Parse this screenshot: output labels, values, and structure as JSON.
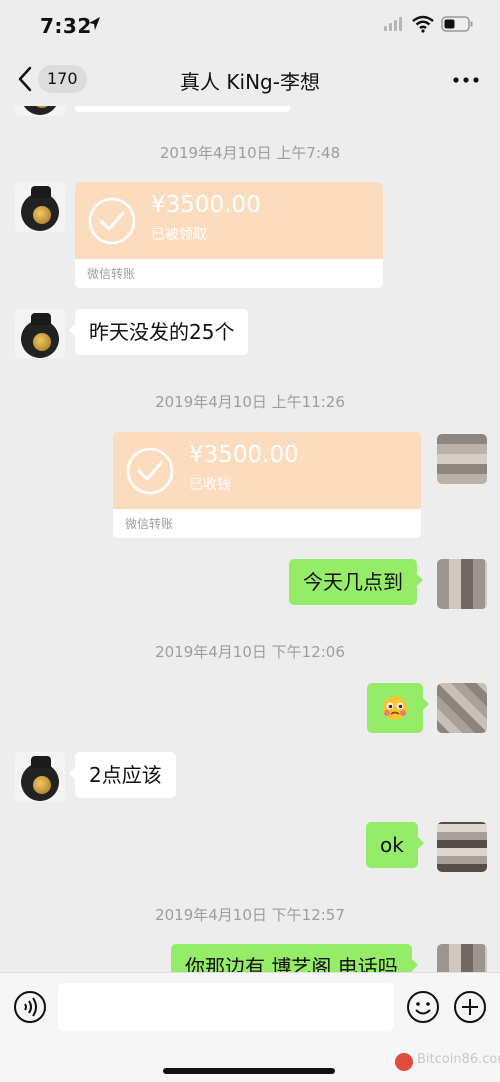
{
  "status_bar": {
    "time": "7:32",
    "icons": [
      "location-arrow-icon",
      "signal-icon",
      "wifi-icon",
      "battery-icon"
    ]
  },
  "nav": {
    "back_count": "170",
    "title": "真人 KiNg-李想",
    "icons": [
      "back-chevron-icon",
      "more-icon"
    ]
  },
  "messages": {
    "ts1": "2019年4月10日 上午7:48",
    "transfer1": {
      "amount": "¥3500.00",
      "status": "已被领取",
      "caption": "微信转账"
    },
    "msg1": "昨天没发的25个",
    "ts2": "2019年4月10日 上午11:26",
    "transfer2": {
      "amount": "¥3500.00",
      "status": "已收钱",
      "caption": "微信转账"
    },
    "msg2": "今天几点到",
    "ts3": "2019年4月10日 下午12:06",
    "msg3": "2点应该",
    "msg4": "ok",
    "ts4": "2019年4月10日 下午12:57",
    "msg5": "你那边有 博艺阁 电话吗"
  },
  "input_bar": {
    "placeholder": "",
    "icons": [
      "voice-icon",
      "emoji-icon",
      "plus-icon"
    ]
  },
  "watermark": {
    "text": "Bitcoin86.com"
  },
  "colors": {
    "background": "#ededed",
    "green_bubble": "#95ec69",
    "transfer": "#fbdcbf"
  }
}
